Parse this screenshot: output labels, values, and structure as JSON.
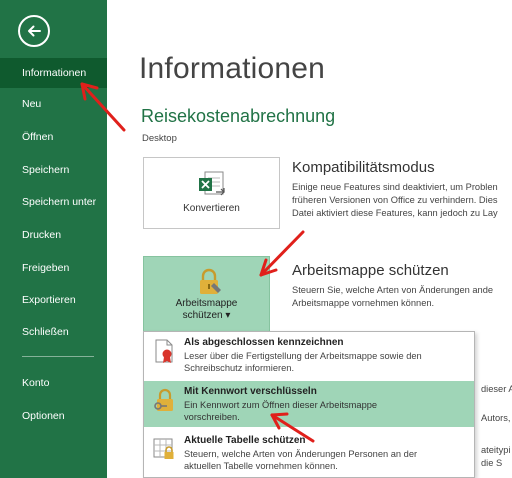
{
  "sidebar": {
    "items": [
      {
        "label": "Informationen",
        "active": true
      },
      {
        "label": "Neu"
      },
      {
        "label": "Öffnen"
      },
      {
        "label": "Speichern"
      },
      {
        "label": "Speichern unter"
      },
      {
        "label": "Drucken"
      },
      {
        "label": "Freigeben"
      },
      {
        "label": "Exportieren"
      },
      {
        "label": "Schließen"
      },
      {
        "label": "Konto"
      },
      {
        "label": "Optionen"
      }
    ]
  },
  "main": {
    "title": "Informationen",
    "document_name": "Reisekostenabrechnung",
    "document_location": "Desktop"
  },
  "compat": {
    "button_label": "Konvertieren",
    "title": "Kompatibilitätsmodus",
    "desc1": "Einige neue Features sind deaktiviert, um Problen",
    "desc2": "früheren Versionen von Office zu verhindern. Dies",
    "desc3": "Datei aktiviert diese Features, kann jedoch zu Lay"
  },
  "protect": {
    "button_line1": "Arbeitsmappe",
    "button_line2": "schützen ▾",
    "title": "Arbeitsmappe schützen",
    "desc1": "Steuern Sie, welche Arten von Änderungen ande",
    "desc2": "Arbeitsmappe vornehmen können.",
    "menu": [
      {
        "title": "Als abgeschlossen kennzeichnen",
        "desc1": "Leser über die Fertigstellung der Arbeitsmappe sowie den",
        "desc2": "Schreibschutz informieren."
      },
      {
        "title": "Mit Kennwort verschlüsseln",
        "desc1": "Ein Kennwort zum Öffnen dieser Arbeitsmappe",
        "desc2": "vorschreiben."
      },
      {
        "title": "Aktuelle Tabelle schützen",
        "desc1": "Steuern, welche Arten von Änderungen Personen an der",
        "desc2": "aktuellen Tabelle vornehmen können."
      }
    ]
  },
  "right_fragments": [
    "dieser Arb",
    "Autors,",
    "ateitypi",
    "die S"
  ],
  "colors": {
    "sidebar_bg": "#217346",
    "sidebar_active": "#0f5a2e",
    "accent_green": "#217346",
    "highlight": "#9fd5b7",
    "arrow_red": "#e0201b"
  },
  "icons": {
    "back": "back-arrow-icon",
    "convert": "excel-convert-icon",
    "protect": "lock-icon",
    "mark_final": "mark-final-icon",
    "encrypt": "encrypt-lock-icon",
    "protect_sheet": "protect-sheet-icon"
  }
}
